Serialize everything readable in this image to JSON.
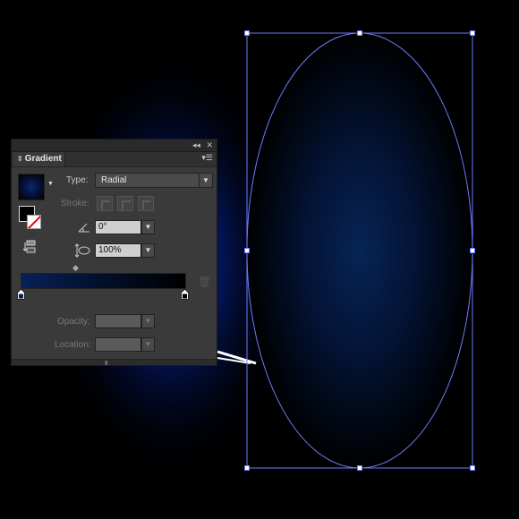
{
  "panel": {
    "title": "Gradient",
    "collapse_icon": "double-chevron-left-icon",
    "close_icon": "close-icon",
    "menu_icon": "panel-menu-icon"
  },
  "type": {
    "label": "Type:",
    "value": "Radial"
  },
  "stroke": {
    "label": "Stroke:"
  },
  "angle": {
    "value": "0°",
    "icon": "angle-icon"
  },
  "aspect": {
    "value": "100%",
    "icon": "aspect-ratio-icon"
  },
  "opacity": {
    "label": "Opacity:",
    "value": ""
  },
  "location": {
    "label": "Location:",
    "value": ""
  },
  "gradient": {
    "start_color": "#072158",
    "end_color": "#000000"
  },
  "colors": {
    "selection": "#6b7bff",
    "panel_bg": "#3a3a3a",
    "glow": "#0a2fa0"
  }
}
